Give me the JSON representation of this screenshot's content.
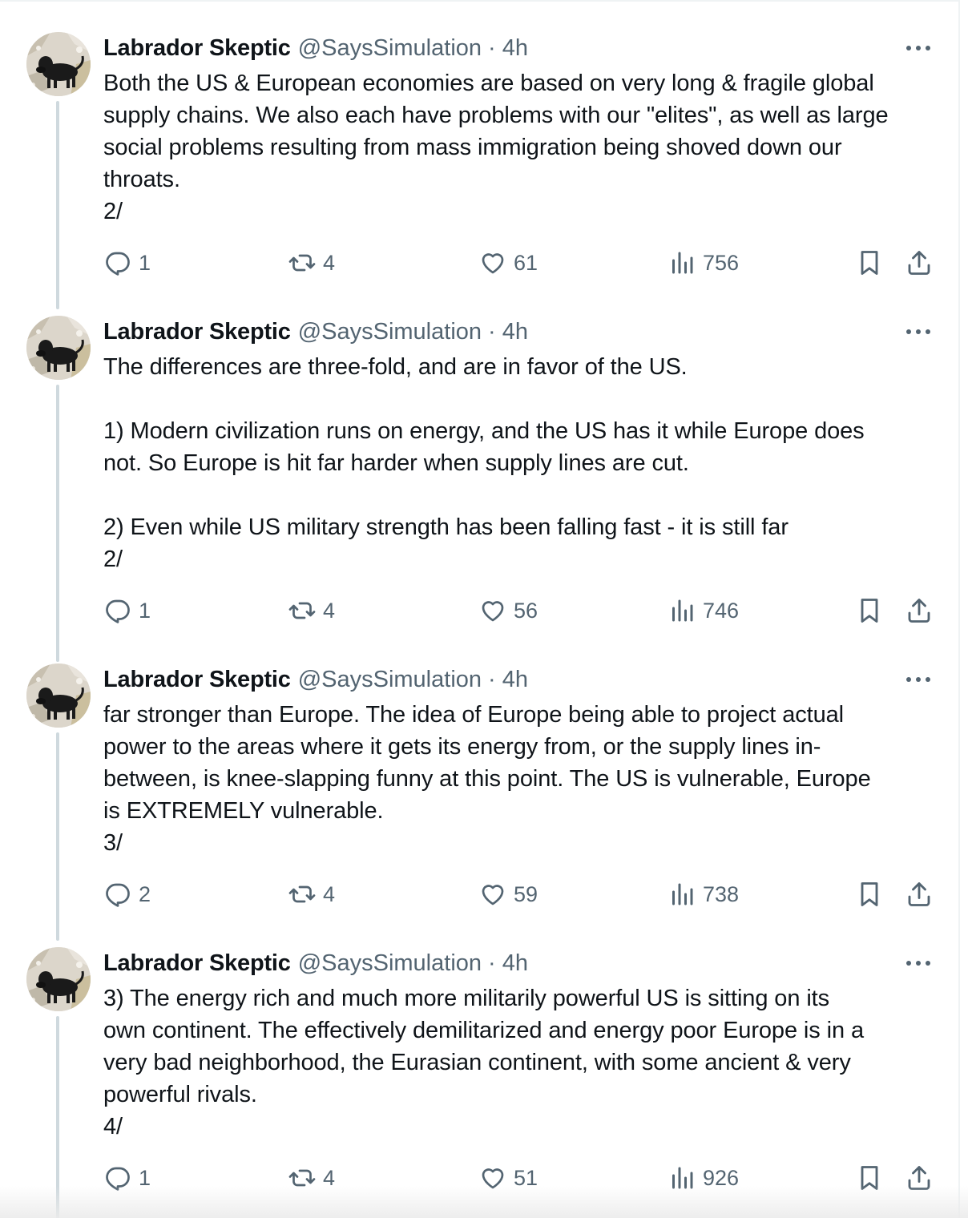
{
  "tweets": [
    {
      "name": "Labrador Skeptic",
      "handle": "@SaysSimulation",
      "separator": "·",
      "time": "4h",
      "lines": [
        "Both the US & European economies are based on very long & fragile global",
        "supply chains. We also each have problems with our \"elites\", as well as large",
        "social problems resulting from mass immigration being shoved down our",
        "throats.",
        "2/"
      ],
      "replies": "1",
      "reposts": "4",
      "likes": "61",
      "views": "756"
    },
    {
      "name": "Labrador Skeptic",
      "handle": "@SaysSimulation",
      "separator": "·",
      "time": "4h",
      "lines": [
        "The differences are three-fold, and are in favor of the US.",
        "",
        "1) Modern civilization runs on energy, and the US has it while Europe does",
        "not. So Europe is hit far harder when supply lines are cut.",
        "",
        "2) Even while US military strength has been falling fast - it is still far",
        "2/"
      ],
      "replies": "1",
      "reposts": "4",
      "likes": "56",
      "views": "746"
    },
    {
      "name": "Labrador Skeptic",
      "handle": "@SaysSimulation",
      "separator": "·",
      "time": "4h",
      "lines": [
        "far stronger than Europe. The idea of Europe being able to project actual",
        "power to the areas where it gets its energy from, or the supply lines in-",
        "between, is knee-slapping funny at this point. The US is vulnerable, Europe",
        "is EXTREMELY vulnerable.",
        "3/"
      ],
      "replies": "2",
      "reposts": "4",
      "likes": "59",
      "views": "738"
    },
    {
      "name": "Labrador Skeptic",
      "handle": "@SaysSimulation",
      "separator": "·",
      "time": "4h",
      "lines": [
        "3) The energy rich and much more militarily powerful US is sitting on its",
        "own continent. The effectively demilitarized and energy poor Europe is in a",
        "very bad neighborhood, the Eurasian continent, with some ancient & very",
        "powerful rivals.",
        "4/"
      ],
      "replies": "1",
      "reposts": "4",
      "likes": "51",
      "views": "926"
    }
  ],
  "icons": {
    "avatar": "black-labrador-photo",
    "more": "more-horizontal-icon",
    "reply": "reply-icon",
    "repost": "repost-icon",
    "like": "heart-icon",
    "views": "views-icon",
    "bookmark": "bookmark-icon",
    "share": "share-icon"
  },
  "colors": {
    "text": "#0f1419",
    "secondary": "#536471",
    "thread_line": "#cfd9de"
  }
}
